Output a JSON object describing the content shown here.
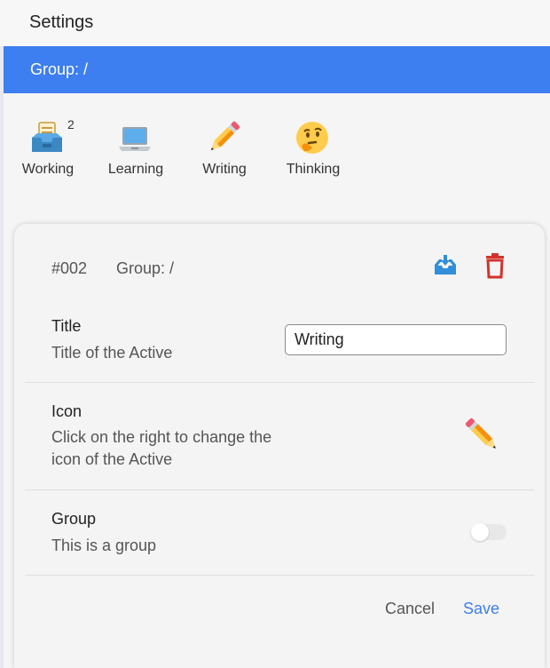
{
  "window": {
    "title": "Settings"
  },
  "group_bar": {
    "label": "Group: /"
  },
  "activities": [
    {
      "name": "Working",
      "icon": "inbox-tray-icon",
      "count": "2"
    },
    {
      "name": "Learning",
      "icon": "laptop-icon"
    },
    {
      "name": "Writing",
      "icon": "pencil-icon"
    },
    {
      "name": "Thinking",
      "icon": "thinking-face-icon"
    }
  ],
  "editor": {
    "id": "#002",
    "group": "Group: /",
    "title_row": {
      "label": "Title",
      "description": "Title of the Active",
      "value": "Writing"
    },
    "icon_row": {
      "label": "Icon",
      "description": "Click on the right to change the icon of the Active",
      "icon": "pencil-icon"
    },
    "group_row": {
      "label": "Group",
      "description": "This is a group",
      "toggle_on": false
    },
    "cancel_label": "Cancel",
    "save_label": "Save"
  },
  "colors": {
    "accent": "#3d7ef0",
    "tray_icon": "#2f8fd8",
    "trash_icon": "#d2342d"
  }
}
